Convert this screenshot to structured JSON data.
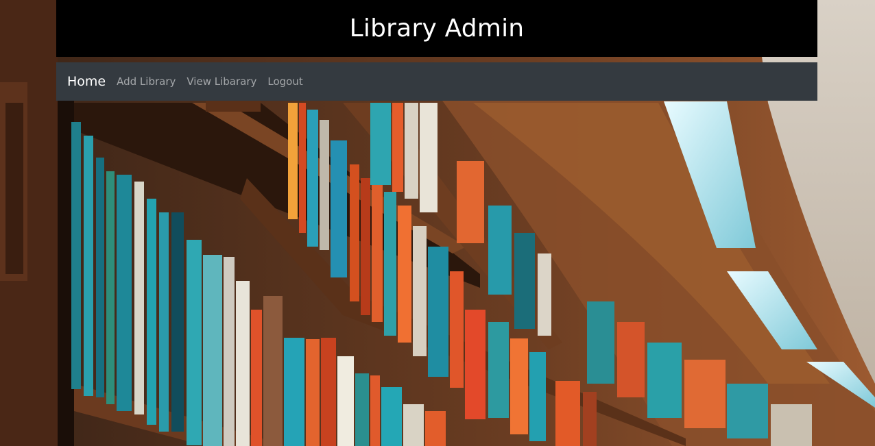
{
  "header": {
    "title": "Library Admin"
  },
  "navbar": {
    "brand": "Home",
    "links": [
      "Add Library",
      "View Libarary",
      "Logout"
    ]
  },
  "colors": {
    "header_bg": "#000000",
    "navbar_bg": "#343a40",
    "brand_text": "#ffffff",
    "link_text": "#9a9da0"
  },
  "background": {
    "image": "library-bookshelves-photo"
  }
}
